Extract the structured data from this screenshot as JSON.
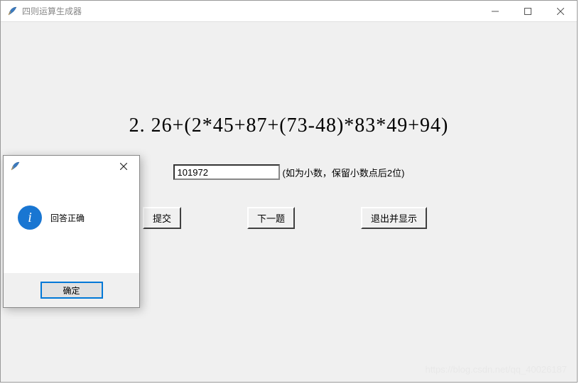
{
  "window": {
    "title": "四则运算生成器"
  },
  "question": {
    "display": "2.  26+(2*45+87+(73-48)*83*49+94)"
  },
  "answer": {
    "value": "101972",
    "hint": "(如为小数，保留小数点后2位)"
  },
  "buttons": {
    "submit": "提交",
    "next": "下一题",
    "exit": "退出并显示"
  },
  "dialog": {
    "message": "回答正确",
    "ok": "确定"
  },
  "watermark": "https://blog.csdn.net/qq_40026187"
}
